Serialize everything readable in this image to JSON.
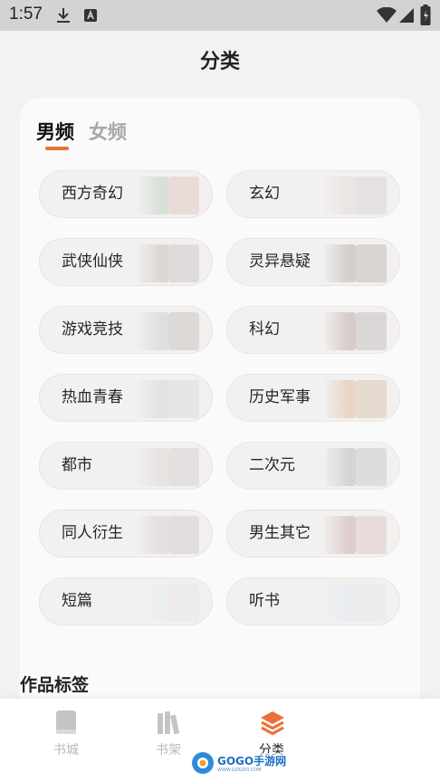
{
  "status_bar": {
    "time": "1:57"
  },
  "page": {
    "title": "分类"
  },
  "tabs": [
    {
      "label": "男频",
      "active": true
    },
    {
      "label": "女频",
      "active": false
    }
  ],
  "categories": [
    {
      "label": "西方奇幻",
      "cover_colors": [
        "#d7ddd6",
        "#e8d8d4"
      ]
    },
    {
      "label": "玄幻",
      "cover_colors": [
        "#e9e2e0",
        "#e4dfe2"
      ]
    },
    {
      "label": "武侠仙侠",
      "cover_colors": [
        "#d8d4d2",
        "#ddd8d8"
      ]
    },
    {
      "label": "灵异悬疑",
      "cover_colors": [
        "#cfcbc9",
        "#d6d1cf"
      ]
    },
    {
      "label": "游戏竞技",
      "cover_colors": [
        "#dcdcdc",
        "#d9d6d4"
      ]
    },
    {
      "label": "科幻",
      "cover_colors": [
        "#d6c6c6",
        "#d8d4d3"
      ]
    },
    {
      "label": "热血青春",
      "cover_colors": [
        "#e0e0e0",
        "#e6e3e3"
      ]
    },
    {
      "label": "历史军事",
      "cover_colors": [
        "#e8d2c0",
        "#e6d8cc"
      ]
    },
    {
      "label": "都市",
      "cover_colors": [
        "#e4e1df",
        "#e2dedd"
      ]
    },
    {
      "label": "二次元",
      "cover_colors": [
        "#d3d1d1",
        "#dcdada"
      ]
    },
    {
      "label": "同人衍生",
      "cover_colors": [
        "#e3dcdc",
        "#e0dcda"
      ]
    },
    {
      "label": "男生其它",
      "cover_colors": [
        "#ddc9c9",
        "#e6d9d7"
      ]
    },
    {
      "label": "短篇",
      "cover_colors": [
        "#ebeef0",
        "#ecebea"
      ]
    },
    {
      "label": "听书",
      "cover_colors": [
        "#e8ebf1",
        "#eceaea"
      ]
    }
  ],
  "section": {
    "title": "作品标签"
  },
  "bottom_nav": [
    {
      "label": "书城",
      "icon": "book-icon",
      "active": false
    },
    {
      "label": "书架",
      "icon": "bookshelf-icon",
      "active": false
    },
    {
      "label": "分类",
      "icon": "layers-icon",
      "active": true
    }
  ],
  "watermark": {
    "text": "GOGO手游网",
    "subtext": "WWW.GOGOO.COM"
  },
  "colors": {
    "accent": "#e8733a",
    "background": "#f4f2f1",
    "card": "#fafafa",
    "pill": "#f2f1f0"
  }
}
